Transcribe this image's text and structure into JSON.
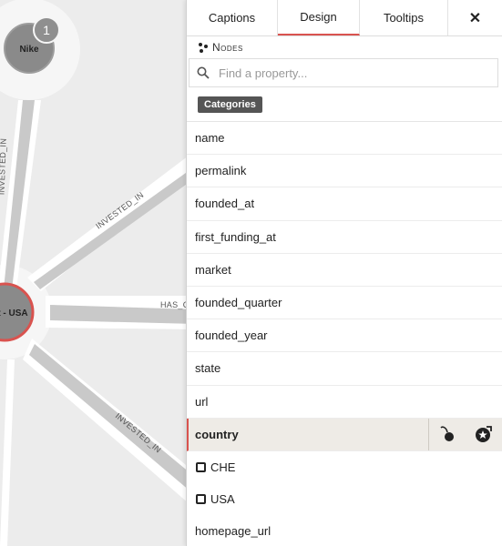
{
  "graph": {
    "nodes": [
      {
        "label": "Nike",
        "badge": "1"
      },
      {
        "label": "t - USA"
      }
    ],
    "relationships": [
      "INVESTED_IN",
      "INVESTED_IN",
      "HAS_C",
      "INVESTED_IN"
    ]
  },
  "panel": {
    "tabs": [
      "Captions",
      "Design",
      "Tooltips"
    ],
    "active_tab": "Design",
    "close_label": "✕",
    "section_label": "Nodes",
    "search": {
      "placeholder": "Find a property..."
    },
    "category_badge": "Categories",
    "properties": [
      "name",
      "permalink",
      "founded_at",
      "first_funding_at",
      "market",
      "founded_quarter",
      "founded_year",
      "state",
      "url"
    ],
    "selected_property": "country",
    "values": [
      "CHE",
      "USA"
    ],
    "after_properties": [
      "homepage_url"
    ]
  }
}
